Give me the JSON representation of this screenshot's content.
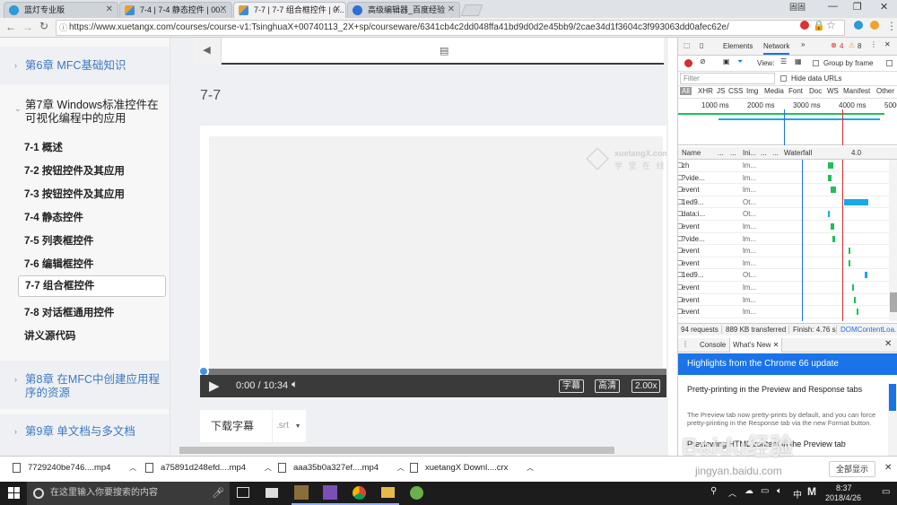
{
  "browser": {
    "tabs": [
      {
        "label": "蓝灯专业版",
        "color": "#2b9ad6"
      },
      {
        "label": "7-4 | 7-4 静态控件 | 00...",
        "color": "#e0a23c"
      },
      {
        "label": "7-7 | 7-7 组合框控件 | 0...",
        "color": "#e0a23c",
        "active": true
      },
      {
        "label": "高级编辑器_百度经验",
        "color": "#2f6fd6"
      }
    ],
    "user_label": "固固",
    "url": "https://www.xuetangx.com/courses/course-v1:TsinghuaX+00740113_2X+sp/courseware/6341cb4c2dd048ffa41bd9d0d2e45bb9/2cae34d1f3604c3f993063dd0afec62e/"
  },
  "sidebar": {
    "chapters": [
      {
        "label": "第6章 MFC基础知识"
      },
      {
        "label": "第7章 Windows标准控件在可视化编程中的应用",
        "expanded": true
      },
      {
        "label": "第8章 在MFC中创建应用程序的资源"
      },
      {
        "label": "第9章 单文档与多文档"
      }
    ],
    "sections": [
      "7-1 概述",
      "7-2 按钮控件及其应用",
      "7-3 按钮控件及其应用",
      "7-4 静态控件",
      "7-5 列表框控件",
      "7-6 编辑框控件",
      "7-7 组合框控件",
      "7-8 对话框通用控件",
      "讲义源代码"
    ],
    "selected_index": 6
  },
  "content": {
    "page_title": "7-7",
    "logo_text": "xuetangX.com",
    "logo_sub": "学 堂 在 线",
    "player": {
      "time": "0:00 / 10:34",
      "subtitle_btn": "字幕",
      "quality_btn": "高清",
      "speed_btn": "2.00x",
      "progress": 0.0
    },
    "download_subtitle": "下载字幕",
    "subtitle_format": ".srt"
  },
  "devtools": {
    "tabs": [
      "Elements",
      "Network"
    ],
    "errors": "4",
    "warnings": "8",
    "view_label": "View:",
    "group_by_frame": "Group by frame",
    "filter_placeholder": "Filter",
    "hide_data_urls": "Hide data URLs",
    "type_filters": [
      "All",
      "XHR",
      "JS",
      "CSS",
      "Img",
      "Media",
      "Font",
      "Doc",
      "WS",
      "Manifest",
      "Other"
    ],
    "timeline_ticks": [
      "1000 ms",
      "2000 ms",
      "3000 ms",
      "4000 ms",
      "5000"
    ],
    "columns": [
      "Name",
      "...",
      "...",
      "Ini...",
      "...",
      "...",
      "Waterfall",
      "4.0"
    ],
    "rows": [
      {
        "name": "zh",
        "init": "lm...",
        "bar_color": "#1fbf59"
      },
      {
        "name": "?vide...",
        "init": "lm...",
        "bar_color": "#1fbf59"
      },
      {
        "name": "event",
        "init": "lm...",
        "bar_color": "#1fbf59"
      },
      {
        "name": "1ed9...",
        "init": "Ot...",
        "bar_color": "#17a9e8"
      },
      {
        "name": "data:i...",
        "init": "Ot...",
        "bar_color": "#17a9e8"
      },
      {
        "name": "event",
        "init": "lm...",
        "bar_color": "#1fbf59"
      },
      {
        "name": "?vide...",
        "init": "lm...",
        "bar_color": "#1fbf59"
      },
      {
        "name": "event",
        "init": "lm...",
        "bar_color": "#1fbf59"
      },
      {
        "name": "event",
        "init": "lm...",
        "bar_color": "#1fbf59"
      },
      {
        "name": "1ed9...",
        "init": "Ot...",
        "bar_color": "#17a9e8"
      },
      {
        "name": "event",
        "init": "lm...",
        "bar_color": "#1fbf59"
      },
      {
        "name": "event",
        "init": "lm...",
        "bar_color": "#1fbf59"
      },
      {
        "name": "event",
        "init": "lm...",
        "bar_color": "#1fbf59"
      }
    ],
    "summary": {
      "requests": "94 requests",
      "transferred": "889 KB transferred",
      "finish": "Finish: 4.76 s",
      "dcl": "DOMContentLoa..."
    },
    "drawer_tabs": [
      "Console",
      "What's New"
    ],
    "whatsnew_header": "Highlights from the Chrome 66 update",
    "whatsnew_title": "Pretty-printing in the Preview and Response tabs",
    "whatsnew_body": "The Preview tab now pretty-prints by default, and you can force pretty-printing in the Response tab via the new Format button.",
    "whatsnew_next": "Previewing HTML content in the Preview tab"
  },
  "downloads": {
    "items": [
      "7729240be746....mp4",
      "a75891d248efd....mp4",
      "aaa35b0a327ef....mp4",
      "xuetangX Downl....crx"
    ],
    "show_all": "全部显示"
  },
  "taskbar": {
    "search_placeholder": "在这里输入你要搜索的内容",
    "ime": "中",
    "time": "8:37",
    "date": "2018/4/26",
    "watermark": "Baidu经验",
    "watermark_url": "jingyan.baidu.com"
  }
}
